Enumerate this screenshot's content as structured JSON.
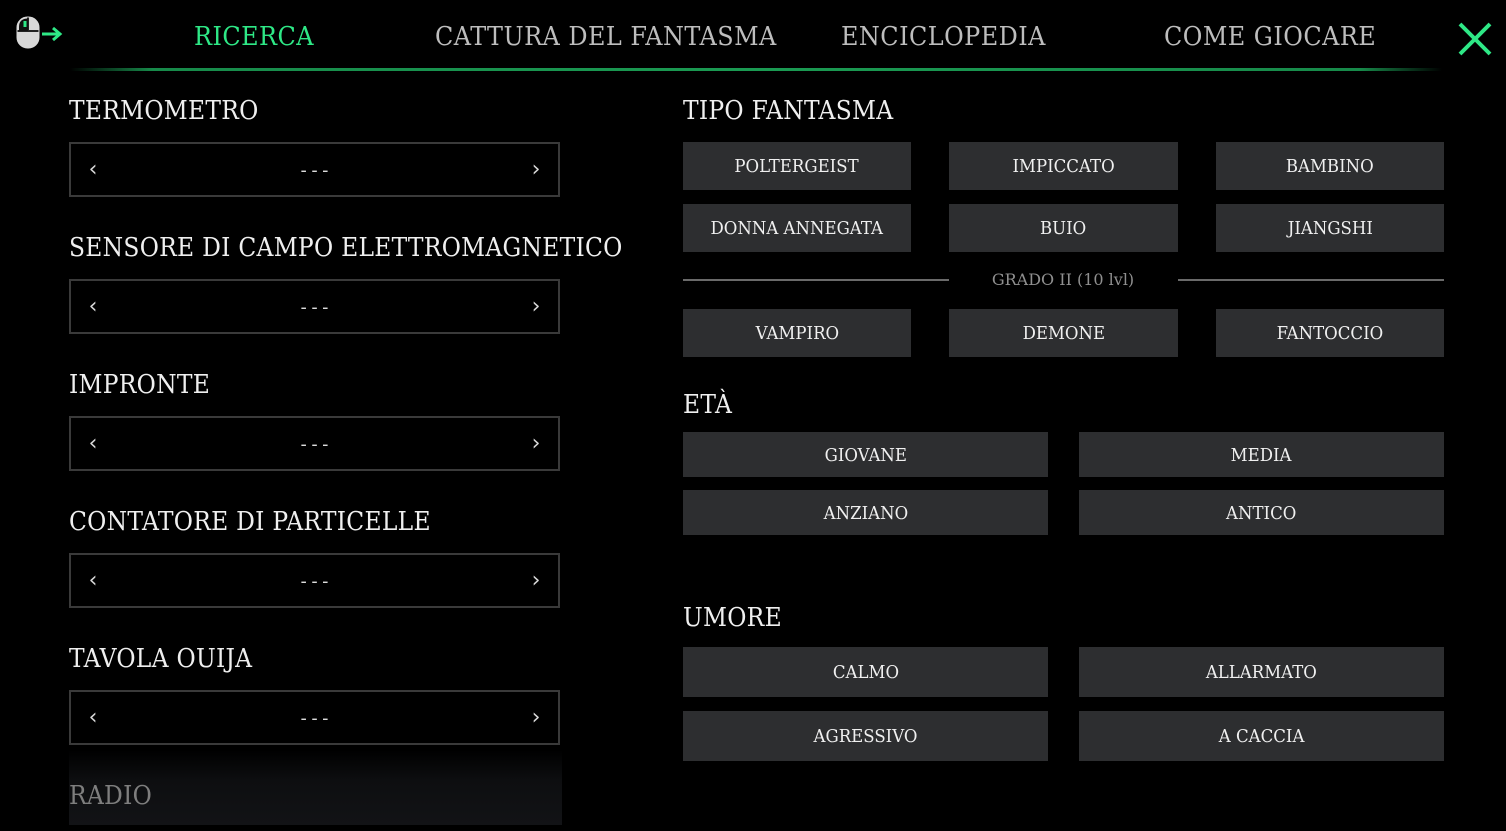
{
  "colors": {
    "background": "#000000",
    "accent": "#2ee886",
    "tab_inactive": "#bdbdbd",
    "option_bg": "#2d2e30",
    "divider": "#1a9a52"
  },
  "nav": {
    "mouse_hint_icon": "mouse-left-click-arrow-icon",
    "tabs": [
      {
        "label": "RICERCA",
        "active": true
      },
      {
        "label": "CATTURA DEL FANTASMA",
        "active": false
      },
      {
        "label": "ENCICLOPEDIA",
        "active": false
      },
      {
        "label": "COME GIOCARE",
        "active": false
      }
    ],
    "close_icon": "close-x-icon"
  },
  "evidence": {
    "items": [
      {
        "label": "TERMOMETRO",
        "value": "---"
      },
      {
        "label": "SENSORE DI CAMPO ELETTROMAGNETICO",
        "value": "---"
      },
      {
        "label": "IMPRONTE",
        "value": "---"
      },
      {
        "label": "CONTATORE DI PARTICELLE",
        "value": "---"
      },
      {
        "label": "TAVOLA OUIJA",
        "value": "---"
      },
      {
        "label": "RADIO"
      }
    ],
    "prev_icon": "chevron-left-icon",
    "next_icon": "chevron-right-icon"
  },
  "ghost_type": {
    "title": "TIPO FANTASMA",
    "options": [
      "POLTERGEIST",
      "IMPICCATO",
      "BAMBINO",
      "DONNA ANNEGATA",
      "BUIO",
      "JIANGSHI"
    ],
    "tier_label": "GRADO II (10 lvl)",
    "tier_options": [
      "VAMPIRO",
      "DEMONE",
      "FANTOCCIO"
    ]
  },
  "age": {
    "title": "ETÀ",
    "options": [
      "GIOVANE",
      "MEDIA",
      "ANZIANO",
      "ANTICO"
    ]
  },
  "mood": {
    "title": "UMORE",
    "options": [
      "CALMO",
      "ALLARMATO",
      "AGRESSIVO",
      "A CACCIA"
    ]
  }
}
